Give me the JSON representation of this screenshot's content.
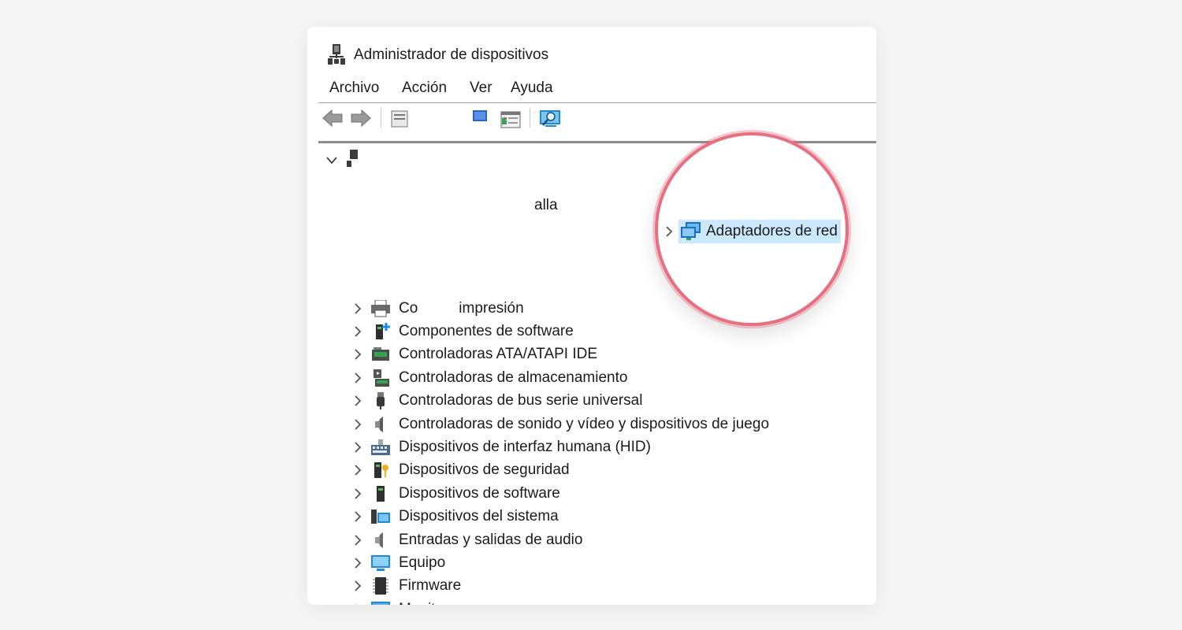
{
  "window": {
    "title": "Administrador de dispositivos",
    "icon": "device-manager-icon"
  },
  "menu": [
    "Archivo",
    "Acción",
    "Ver",
    "Ayuda"
  ],
  "toolbar": {
    "buttons": [
      "back-arrow-icon",
      "forward-arrow-icon",
      "properties-icon",
      "update-driver-icon",
      "show-hidden-icon",
      "scan-hardware-icon"
    ]
  },
  "tree": {
    "root_expander": "chevron-down-icon",
    "partial_label_suffix": "alla",
    "partial_label_fragment_1": "Co",
    "partial_label_fragment_2": "impresión",
    "selected": {
      "label": "Adaptadores de red",
      "icon": "network-adapter-icon",
      "highlight_color": "#cce8ff"
    },
    "items": [
      {
        "label": "Componentes de software",
        "icon": "software-component-icon"
      },
      {
        "label": "Controladoras ATA/ATAPI IDE",
        "icon": "ide-controller-icon"
      },
      {
        "label": "Controladoras de almacenamiento",
        "icon": "storage-controller-icon"
      },
      {
        "label": "Controladoras de bus serie universal",
        "icon": "usb-icon"
      },
      {
        "label": "Controladoras de sonido y vídeo y dispositivos de juego",
        "icon": "speaker-icon"
      },
      {
        "label": "Dispositivos de interfaz humana (HID)",
        "icon": "hid-icon"
      },
      {
        "label": "Dispositivos de seguridad",
        "icon": "security-device-icon"
      },
      {
        "label": "Dispositivos de software",
        "icon": "software-device-icon"
      },
      {
        "label": "Dispositivos del sistema",
        "icon": "system-devices-icon"
      },
      {
        "label": "Entradas y salidas de audio",
        "icon": "audio-io-icon"
      },
      {
        "label": "Equipo",
        "icon": "computer-icon"
      },
      {
        "label": "Firmware",
        "icon": "firmware-chip-icon"
      },
      {
        "label": "Monitores",
        "icon": "monitor-icon"
      }
    ]
  },
  "magnifier": {
    "border_color": "#e86e82"
  },
  "colors": {
    "background": "#f5f5f5",
    "window": "#ffffff",
    "text": "#1b1b1b"
  }
}
